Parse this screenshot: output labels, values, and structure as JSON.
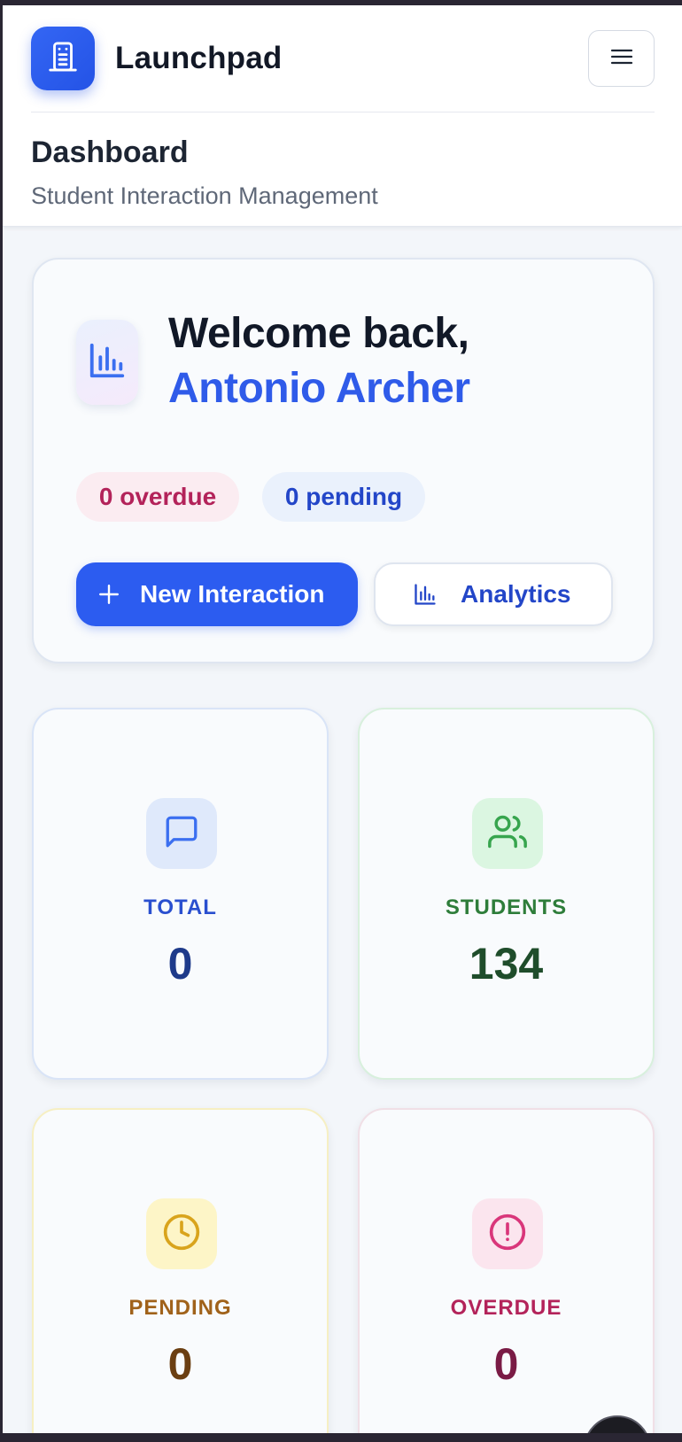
{
  "header": {
    "app_name": "Launchpad",
    "page_title": "Dashboard",
    "page_subtitle": "Student Interaction Management",
    "logo_icon": "building-icon",
    "menu_icon": "hamburger-menu-icon"
  },
  "welcome": {
    "greeting": "Welcome back,",
    "user_name": "Antonio Archer",
    "icon": "bar-chart-icon",
    "overdue_pill": "0 overdue",
    "pending_pill": "0 pending",
    "new_interaction_label": "New Interaction",
    "analytics_label": "Analytics"
  },
  "stats": [
    {
      "label": "TOTAL",
      "value": "0",
      "icon": "message-square-icon",
      "color": "#2a4fcf"
    },
    {
      "label": "STUDENTS",
      "value": "134",
      "icon": "users-icon",
      "color": "#2e7d3a"
    },
    {
      "label": "PENDING",
      "value": "0",
      "icon": "clock-icon",
      "color": "#a0621a"
    },
    {
      "label": "OVERDUE",
      "value": "0",
      "icon": "alert-circle-icon",
      "color": "#b3235a"
    }
  ],
  "colors": {
    "accent": "#2c5cf0",
    "background": "#f3f6fa"
  }
}
